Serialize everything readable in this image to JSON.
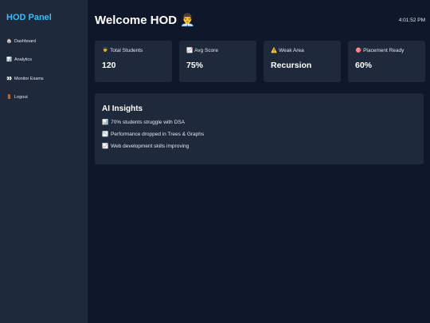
{
  "sidebar": {
    "brand": "HOD Panel",
    "items": [
      {
        "icon": "🏠",
        "label": "Dashboard"
      },
      {
        "icon": "📊",
        "label": "Analytics"
      },
      {
        "icon": "👀",
        "label": "Monitor Exams"
      },
      {
        "icon": "🚪",
        "label": "Logout"
      }
    ]
  },
  "header": {
    "title": "Welcome HOD 👨‍💼",
    "time": "4:01:52 PM"
  },
  "cards": [
    {
      "icon": "👨‍🎓",
      "label": "Total Students",
      "value": "120"
    },
    {
      "icon": "📈",
      "label": "Avg Score",
      "value": "75%"
    },
    {
      "icon": "⚠️",
      "label": "Weak Area",
      "value": "Recursion"
    },
    {
      "icon": "🎯",
      "label": "Placement Ready",
      "value": "60%"
    }
  ],
  "insights": {
    "title": "AI Insights",
    "items": [
      {
        "icon": "📊",
        "text": "70% students struggle with DSA"
      },
      {
        "icon": "📉",
        "text": "Performance dropped in Trees & Graphs"
      },
      {
        "icon": "📈",
        "text": "Web development skills improving"
      }
    ]
  }
}
